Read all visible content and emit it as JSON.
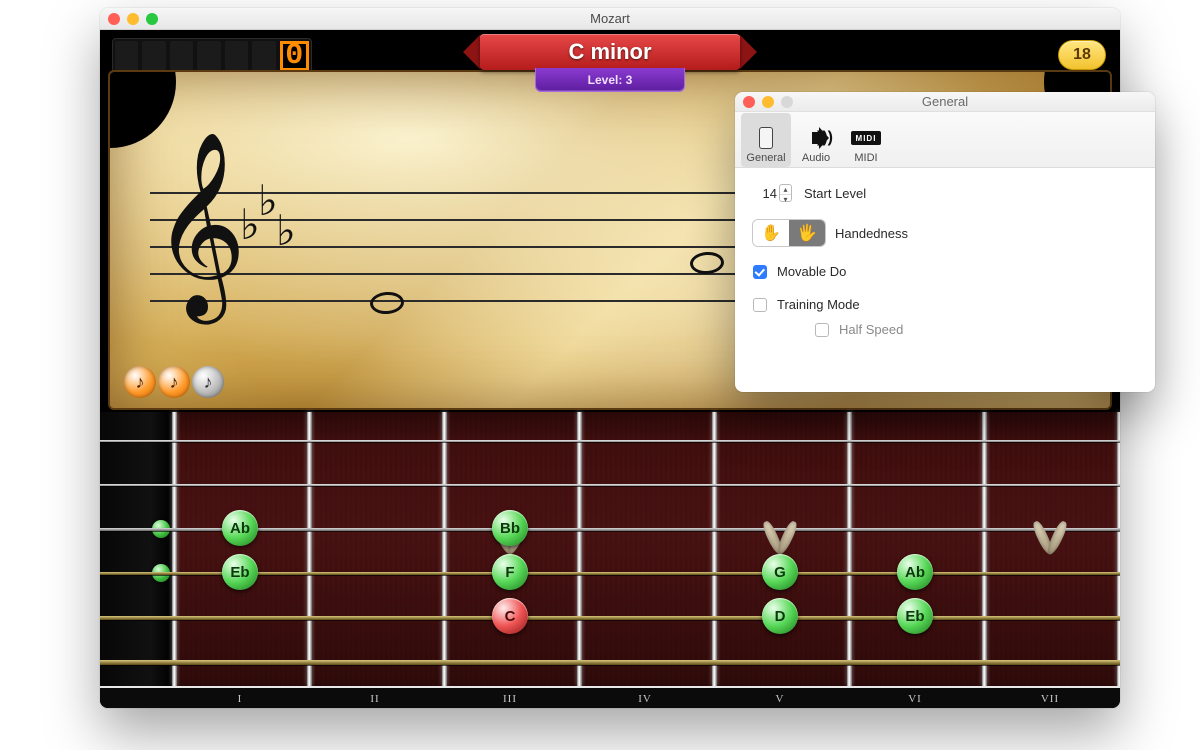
{
  "main_window": {
    "title": "Mozart"
  },
  "hud": {
    "score_digits": 7,
    "score_value": "0",
    "key_name": "C minor",
    "level_label": "Level: 3",
    "pill_value": "18"
  },
  "hint_orbs": [
    "♪",
    "♪",
    "♪"
  ],
  "fretboard": {
    "romans": [
      "I",
      "II",
      "III",
      "IV",
      "V",
      "VI",
      "VII"
    ],
    "notes": [
      {
        "label": "Ab",
        "string": 2,
        "fret": 1,
        "root": false
      },
      {
        "label": "Eb",
        "string": 3,
        "fret": 1,
        "root": false
      },
      {
        "label": "Bb",
        "string": 2,
        "fret": 3,
        "root": false
      },
      {
        "label": "F",
        "string": 3,
        "fret": 3,
        "root": false
      },
      {
        "label": "C",
        "string": 4,
        "fret": 3,
        "root": true
      },
      {
        "label": "G",
        "string": 3,
        "fret": 5,
        "root": false
      },
      {
        "label": "D",
        "string": 4,
        "fret": 5,
        "root": false
      },
      {
        "label": "Ab",
        "string": 3,
        "fret": 6,
        "root": false
      },
      {
        "label": "Eb",
        "string": 4,
        "fret": 6,
        "root": false
      }
    ]
  },
  "prefs": {
    "title": "General",
    "tabs": {
      "general": "General",
      "audio": "Audio",
      "midi": "MIDI"
    },
    "start_level_value": "14",
    "start_level_label": "Start Level",
    "handedness_label": "Handedness",
    "movable_do_label": "Movable Do",
    "training_mode_label": "Training Mode",
    "half_speed_label": "Half Speed",
    "movable_do_checked": true,
    "training_mode_checked": false,
    "half_speed_checked": false
  }
}
